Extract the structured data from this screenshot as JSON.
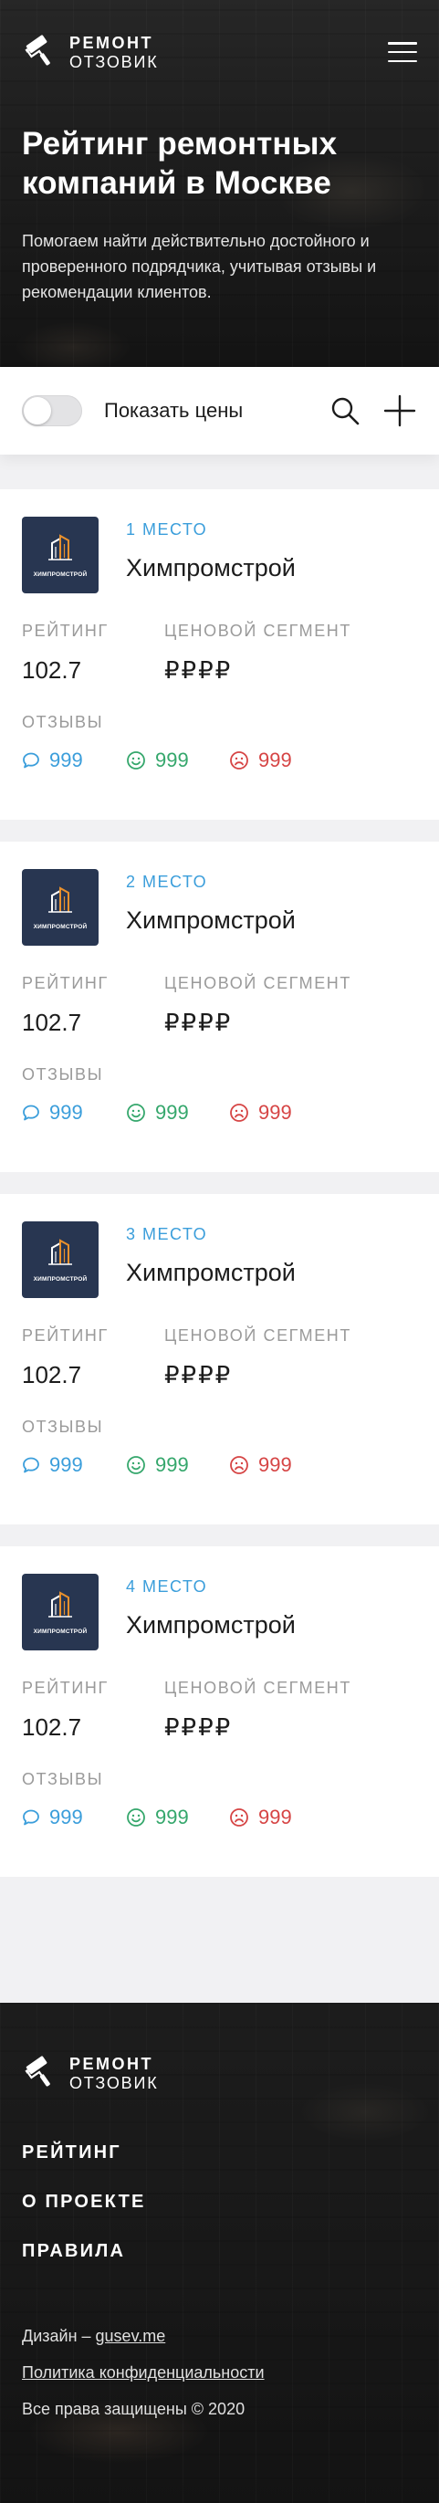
{
  "brand": {
    "line1": "РЕМОНТ",
    "line2": "ОТЗОВИК"
  },
  "hero": {
    "title": "Рейтинг ремонтных компаний в Москве",
    "text": "Помогаем найти действительно достойного и проверенного подрядчика, учитывая отзывы и рекомендации клиентов."
  },
  "filters": {
    "toggle_label": "Показать цены",
    "toggle_on": false
  },
  "labels": {
    "rating": "РЕЙТИНГ",
    "price_segment": "ЦЕНОВОЙ СЕГМЕНТ",
    "reviews": "ОТЗЫВЫ"
  },
  "companies": [
    {
      "place": "1 МЕСТО",
      "name": "Химпромстрой",
      "logo_text": "ХИМПРОМСТРОЙ",
      "rating": "102.7",
      "price": "₽₽₽₽",
      "reviews_total": "999",
      "reviews_positive": "999",
      "reviews_negative": "999"
    },
    {
      "place": "2 МЕСТО",
      "name": "Химпромстрой",
      "logo_text": "ХИМПРОМСТРОЙ",
      "rating": "102.7",
      "price": "₽₽₽₽",
      "reviews_total": "999",
      "reviews_positive": "999",
      "reviews_negative": "999"
    },
    {
      "place": "3 МЕСТО",
      "name": "Химпромстрой",
      "logo_text": "ХИМПРОМСТРОЙ",
      "rating": "102.7",
      "price": "₽₽₽₽",
      "reviews_total": "999",
      "reviews_positive": "999",
      "reviews_negative": "999"
    },
    {
      "place": "4 МЕСТО",
      "name": "Химпромстрой",
      "logo_text": "ХИМПРОМСТРОЙ",
      "rating": "102.7",
      "price": "₽₽₽₽",
      "reviews_total": "999",
      "reviews_positive": "999",
      "reviews_negative": "999"
    }
  ],
  "footer": {
    "nav": [
      "РЕЙТИНГ",
      "О ПРОЕКТЕ",
      "ПРАВИЛА"
    ],
    "design_prefix": "Дизайн – ",
    "design_link": "gusev.me",
    "privacy": "Политика конфиденциальности",
    "copyright": "Все права защищены © 2020"
  },
  "colors": {
    "accent_blue": "#3b9edb",
    "positive_green": "#35a76c",
    "negative_red": "#d64545",
    "company_logo_bg": "#283651"
  },
  "icons": [
    "roller-logo-icon",
    "menu-icon",
    "search-icon",
    "plus-icon",
    "comment-icon",
    "smile-icon",
    "frown-icon",
    "building-logo-icon"
  ]
}
